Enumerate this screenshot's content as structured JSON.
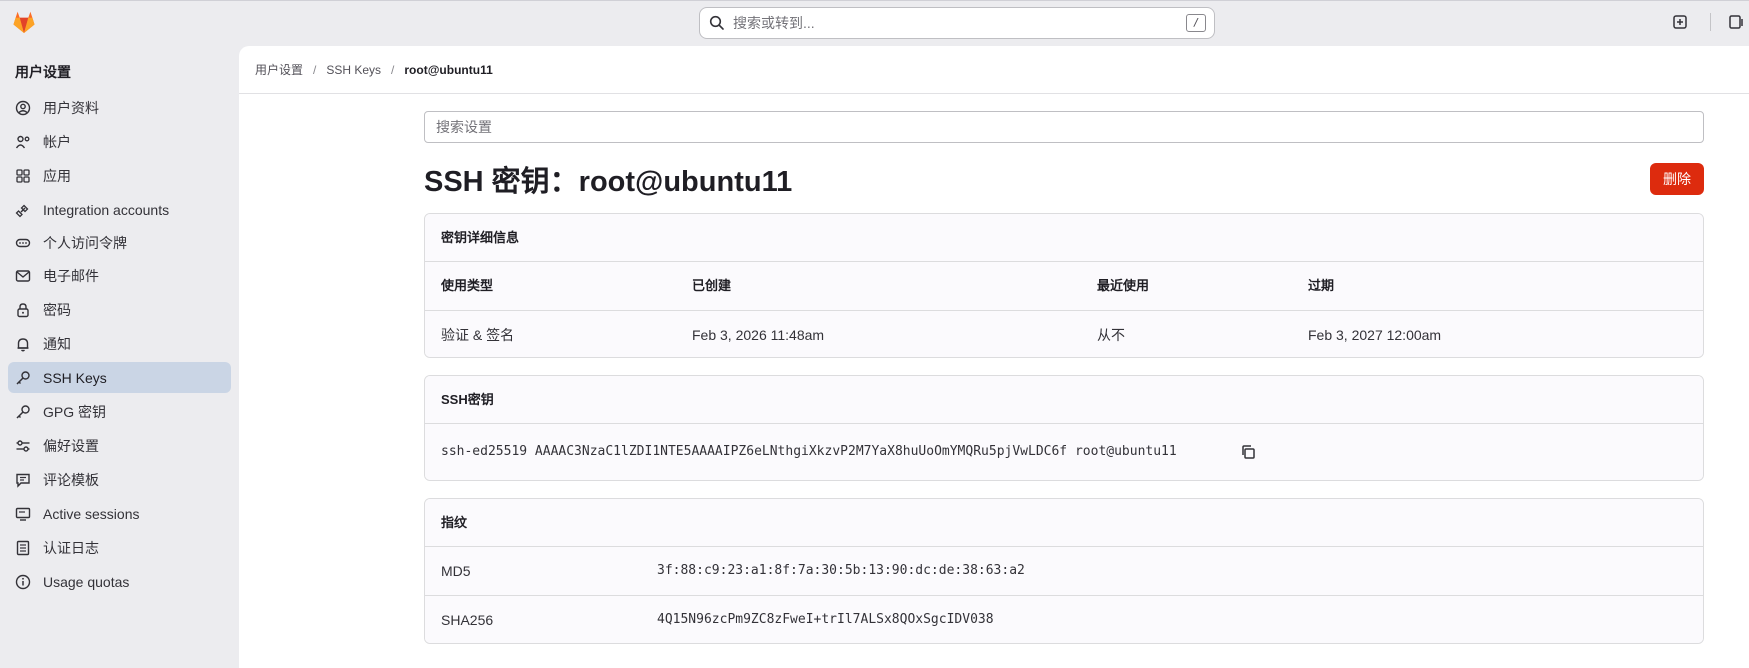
{
  "topbar": {
    "search_placeholder": "搜索或转到...",
    "search_shortcut": "/"
  },
  "sidebar": {
    "title": "用户设置",
    "items": [
      {
        "label": "用户资料",
        "icon": "profile-icon"
      },
      {
        "label": "帐户",
        "icon": "account-icon"
      },
      {
        "label": "应用",
        "icon": "applications-icon"
      },
      {
        "label": "Integration accounts",
        "icon": "integration-icon"
      },
      {
        "label": "个人访问令牌",
        "icon": "token-icon"
      },
      {
        "label": "电子邮件",
        "icon": "mail-icon"
      },
      {
        "label": "密码",
        "icon": "lock-icon"
      },
      {
        "label": "通知",
        "icon": "bell-icon"
      },
      {
        "label": "SSH Keys",
        "icon": "key-icon",
        "active": true
      },
      {
        "label": "GPG 密钥",
        "icon": "key-icon"
      },
      {
        "label": "偏好设置",
        "icon": "preferences-icon"
      },
      {
        "label": "评论模板",
        "icon": "comment-icon"
      },
      {
        "label": "Active sessions",
        "icon": "monitor-icon"
      },
      {
        "label": "认证日志",
        "icon": "log-icon"
      },
      {
        "label": "Usage quotas",
        "icon": "info-icon"
      }
    ]
  },
  "breadcrumb": [
    "用户设置",
    "SSH Keys",
    "root@ubuntu11"
  ],
  "settings_search_placeholder": "搜索设置",
  "page_title": "SSH 密钥：root@ubuntu11",
  "delete_label": "删除",
  "details_card": {
    "title": "密钥详细信息",
    "headers": [
      "使用类型",
      "已创建",
      "最近使用",
      "过期"
    ],
    "values": [
      "验证 & 签名",
      "Feb 3, 2026 11:48am",
      "从不",
      "Feb 3, 2027 12:00am"
    ]
  },
  "ssh_card": {
    "title": "SSH密钥",
    "key": "ssh-ed25519 AAAAC3NzaC1lZDI1NTE5AAAAIPZ6eLNthgiXkzvP2M7YaX8huUoOmYMQRu5pjVwLDC6f root@ubuntu11"
  },
  "fingerprint_card": {
    "title": "指纹",
    "rows": [
      {
        "label": "MD5",
        "value": "3f:88:c9:23:a1:8f:7a:30:5b:13:90:dc:de:38:63:a2"
      },
      {
        "label": "SHA256",
        "value": "4Q15N96zcPm9ZC8zFweI+trIl7ALSx8QOxSgcIDV038"
      }
    ]
  },
  "colors": {
    "accent_active": "#cad5e5",
    "danger": "#dd2b0e",
    "logo_orange": "#e24329"
  }
}
